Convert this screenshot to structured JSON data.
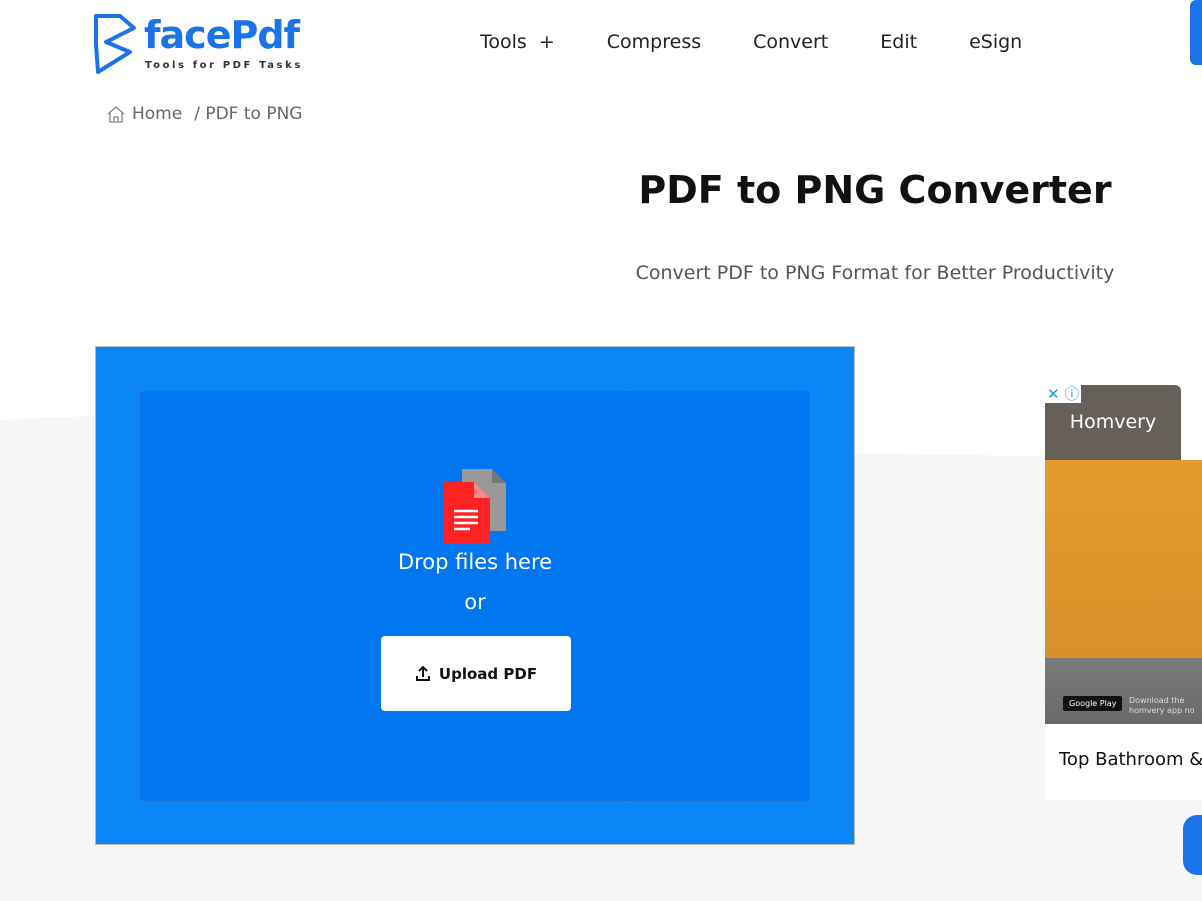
{
  "logo": {
    "name": "facePdf",
    "tagline": "Tools for PDF Tasks"
  },
  "nav": {
    "items": [
      "Tools",
      "Compress",
      "Convert",
      "Edit",
      "eSign"
    ],
    "tools_plus": "+"
  },
  "breadcrumb": {
    "home": "Home",
    "current": "/ PDF to PNG"
  },
  "page": {
    "title": "PDF to PNG Converter",
    "subtitle": "Convert PDF to PNG Format for Better Productivity"
  },
  "upload": {
    "drop_text": "Drop files here",
    "or_text": "or",
    "button_label": "Upload PDF",
    "color": "#0a86f6"
  },
  "ad": {
    "brand": "Homvery",
    "play_badge": "Google Play",
    "download_text": "Download the homvery app no",
    "caption": "Top Bathroom &"
  }
}
